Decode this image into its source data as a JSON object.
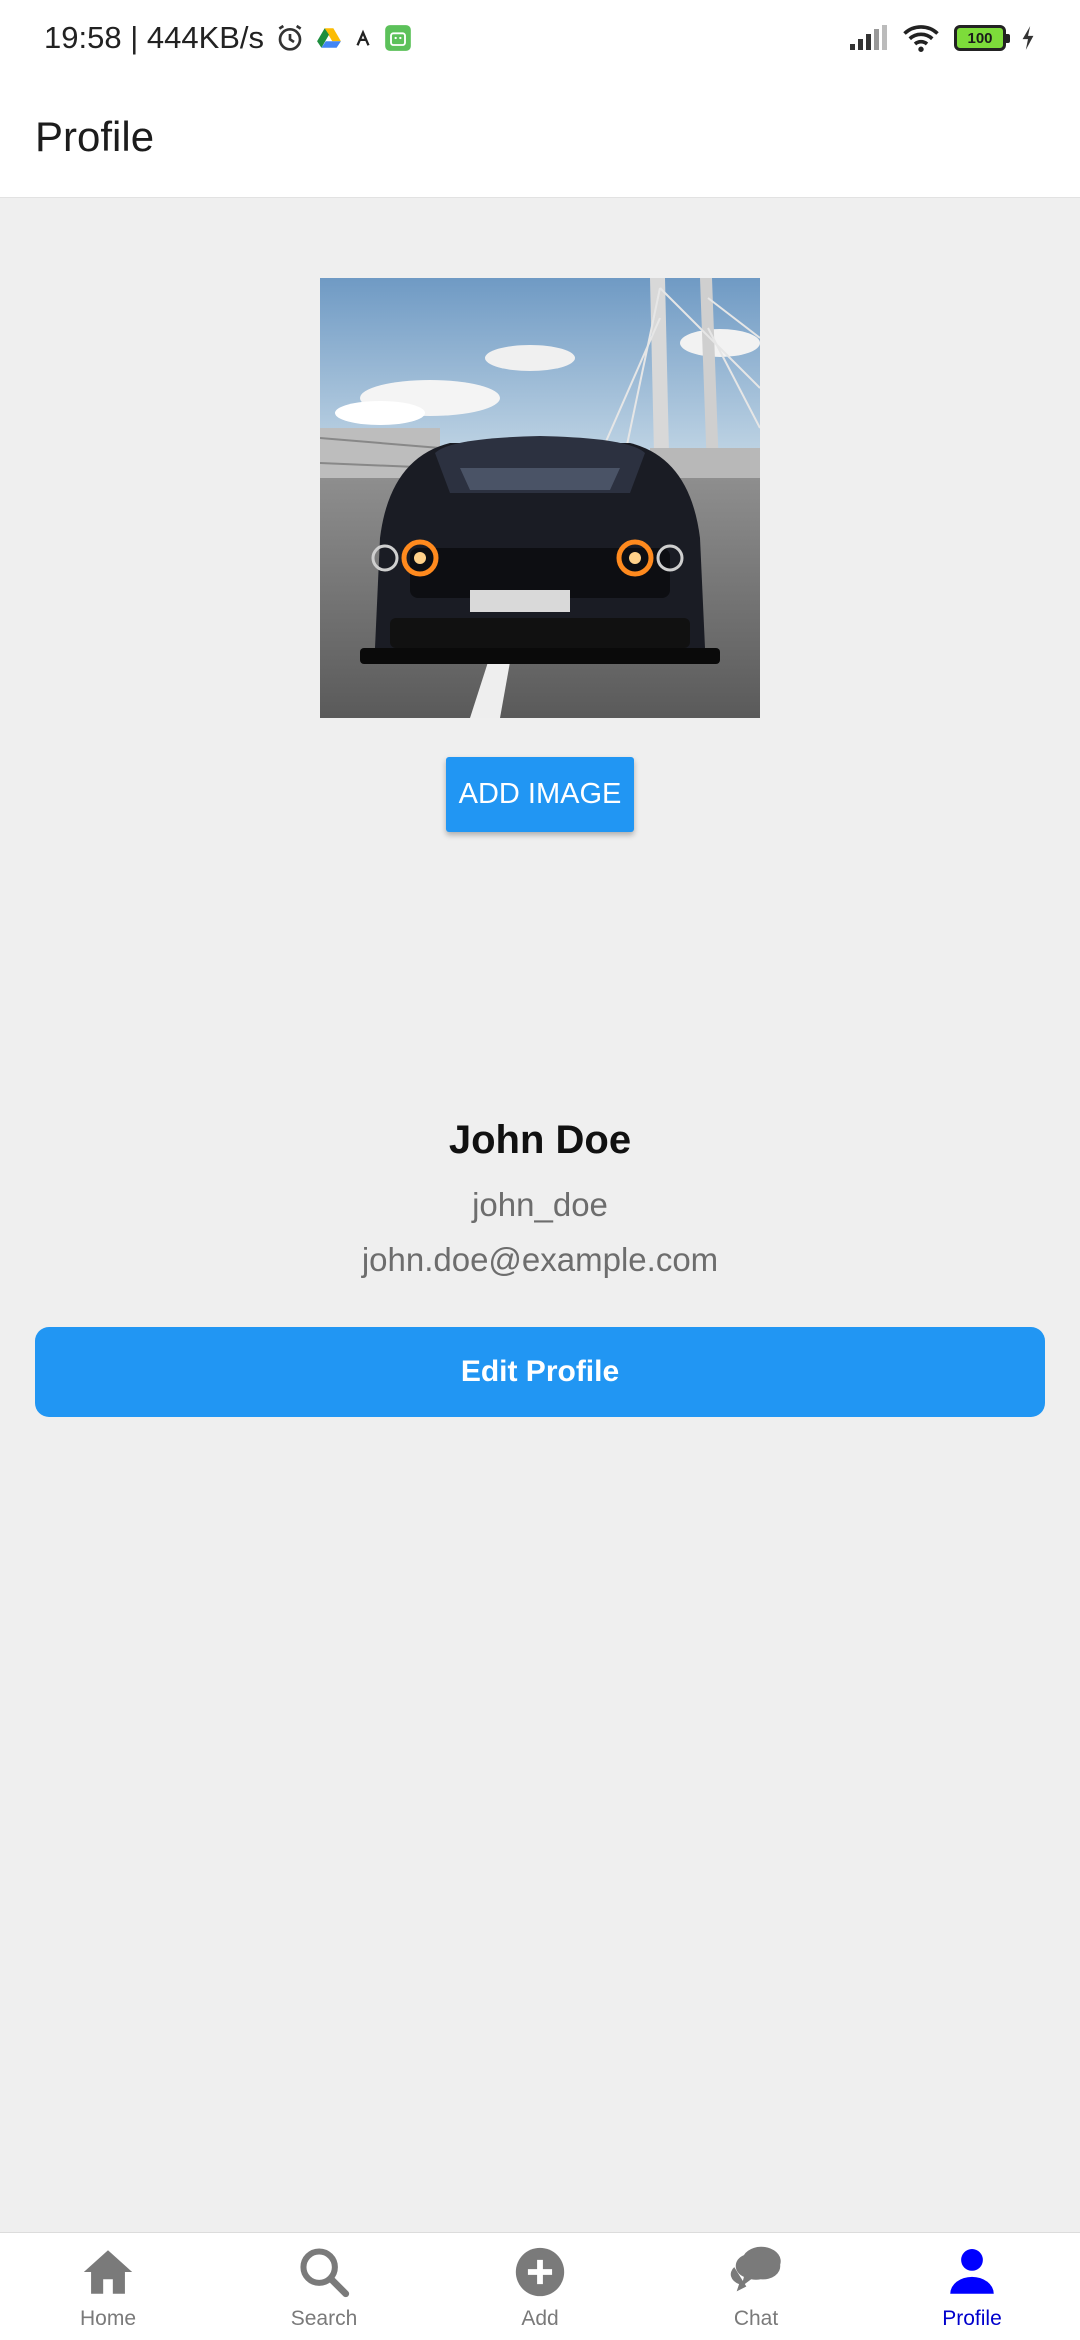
{
  "status": {
    "time": "19:58 | 444KB/s",
    "battery": "100",
    "icons": [
      "alarm-icon",
      "drive-icon",
      "app-icon",
      "android-icon",
      "signal-icon",
      "wifi-icon",
      "battery-icon",
      "charging-icon"
    ]
  },
  "appbar": {
    "title": "Profile"
  },
  "profile": {
    "photo_alt": "car photo",
    "add_image_label": "ADD IMAGE",
    "name": "John Doe",
    "username": "john_doe",
    "email": "john.doe@example.com",
    "edit_label": "Edit Profile"
  },
  "nav": {
    "items": [
      {
        "label": "Home",
        "icon": "home-icon",
        "active": false
      },
      {
        "label": "Search",
        "icon": "search-icon",
        "active": false
      },
      {
        "label": "Add",
        "icon": "add-icon",
        "active": false
      },
      {
        "label": "Chat",
        "icon": "chat-icon",
        "active": false
      },
      {
        "label": "Profile",
        "icon": "profile-icon",
        "active": true
      }
    ]
  },
  "colors": {
    "accent": "#2196f3",
    "active_nav": "#0000cc",
    "inactive_nav": "#7a7a7a",
    "background": "#efefef"
  }
}
